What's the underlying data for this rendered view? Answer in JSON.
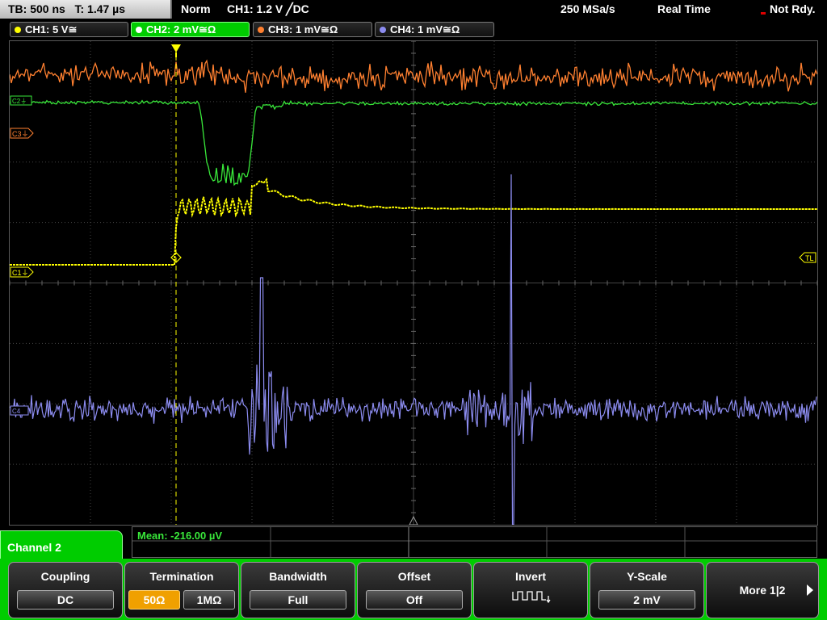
{
  "status_bar": {
    "timebase": "TB: 500 ns",
    "trigger_time": "T: 1.47 µs",
    "mode": "Norm",
    "trigger": "CH1: 1.2 V ╱DC",
    "sample_rate": "250 MSa/s",
    "acq_mode": "Real Time",
    "state": "Not Rdy."
  },
  "channel_tabs": [
    {
      "label": "CH1: 5 V≅",
      "color": "#ffff00"
    },
    {
      "label": "CH2: 2 mV≅Ω",
      "color": "#39e83a",
      "active": true
    },
    {
      "label": "CH3: 1 mV≅Ω",
      "color": "#ff8030"
    },
    {
      "label": "CH4: 1 mV≅Ω",
      "color": "#8c8cf0"
    }
  ],
  "markers": {
    "c1": "C1⏚",
    "c2": "C2⏚",
    "c3": "C3⏚",
    "c4": "C4",
    "tl": "TL"
  },
  "measurement": {
    "label": "Mean: -216.00 µV"
  },
  "channel_label": "Channel 2",
  "softkeys": {
    "coupling": {
      "title": "Coupling",
      "value": "DC"
    },
    "termination": {
      "title": "Termination",
      "opt1": "50Ω",
      "opt2": "1MΩ"
    },
    "bandwidth": {
      "title": "Bandwidth",
      "value": "Full"
    },
    "offset": {
      "title": "Offset",
      "value": "Off"
    },
    "invert": {
      "title": "Invert",
      "icon": "invert-pulse-icon"
    },
    "yscale": {
      "title": "Y-Scale",
      "value": "2 mV"
    },
    "more": {
      "label": "More 1|2"
    }
  },
  "colors": {
    "ch1": "#ffff00",
    "ch2": "#39e83a",
    "ch3": "#ff8030",
    "ch4": "#8c8cf0",
    "grid": "#555555",
    "softkey_bar": "#00cc00",
    "selected_option": "#f0a000"
  }
}
